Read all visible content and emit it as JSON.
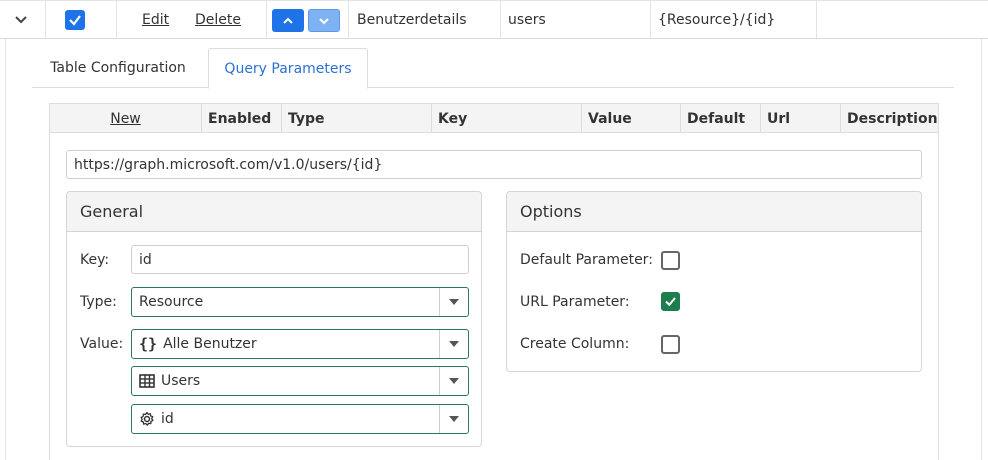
{
  "row": {
    "edit_label": "Edit",
    "delete_label": "Delete",
    "name": "Benutzerdetails",
    "resource": "users",
    "path": "{Resource}/{id}"
  },
  "tabs": [
    {
      "label": "Table Configuration",
      "active": false
    },
    {
      "label": "Query Parameters",
      "active": true
    }
  ],
  "grid": {
    "headers": [
      "New",
      "Enabled",
      "Type",
      "Key",
      "Value",
      "Default",
      "Url",
      "Description"
    ]
  },
  "url": "https://graph.microsoft.com/v1.0/users/{id}",
  "general": {
    "title": "General",
    "key_label": "Key:",
    "key_value": "id",
    "type_label": "Type:",
    "type_value": "Resource",
    "value_label": "Value:",
    "value_selects": [
      {
        "icon": "braces-icon",
        "text": "Alle Benutzer"
      },
      {
        "icon": "table-icon",
        "text": "Users"
      },
      {
        "icon": "gear-icon",
        "text": "id"
      }
    ]
  },
  "options": {
    "title": "Options",
    "items": [
      {
        "label": "Default Parameter:",
        "checked": false
      },
      {
        "label": "URL Parameter:",
        "checked": true
      },
      {
        "label": "Create Column:",
        "checked": false
      }
    ]
  },
  "colors": {
    "accent_blue": "#1f73e8",
    "check_green": "#1e7d4e",
    "select_border": "#2a7a57",
    "tab_active": "#2e6fd3"
  }
}
